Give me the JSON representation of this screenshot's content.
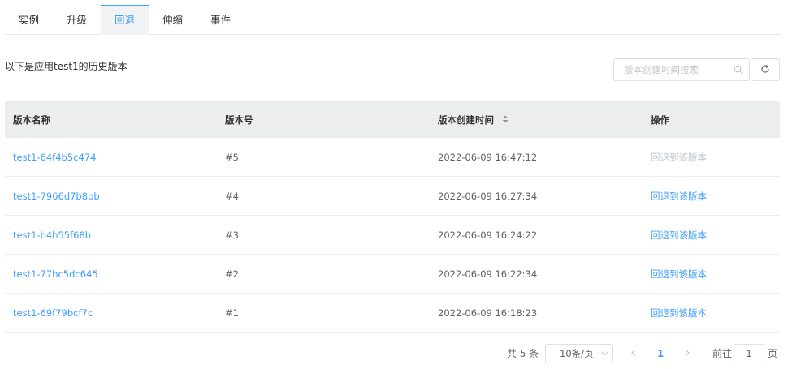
{
  "tabs": [
    {
      "label": "实例",
      "active": false
    },
    {
      "label": "升级",
      "active": false
    },
    {
      "label": "回退",
      "active": true
    },
    {
      "label": "伸缩",
      "active": false
    },
    {
      "label": "事件",
      "active": false
    }
  ],
  "description": "以下是应用test1的历史版本",
  "search": {
    "placeholder": "版本创建时间搜索",
    "value": ""
  },
  "table": {
    "headers": {
      "name": "版本名称",
      "version": "版本号",
      "created": "版本创建时间",
      "action": "操作"
    },
    "rows": [
      {
        "name": "test1-64f4b5c474",
        "version": "#5",
        "created": "2022-06-09 16:47:12",
        "action": "回退到该版本",
        "action_disabled": true
      },
      {
        "name": "test1-7966d7b8bb",
        "version": "#4",
        "created": "2022-06-09 16:27:34",
        "action": "回退到该版本",
        "action_disabled": false
      },
      {
        "name": "test1-b4b55f68b",
        "version": "#3",
        "created": "2022-06-09 16:24:22",
        "action": "回退到该版本",
        "action_disabled": false
      },
      {
        "name": "test1-77bc5dc645",
        "version": "#2",
        "created": "2022-06-09 16:22:34",
        "action": "回退到该版本",
        "action_disabled": false
      },
      {
        "name": "test1-69f79bcf7c",
        "version": "#1",
        "created": "2022-06-09 16:18:23",
        "action": "回退到该版本",
        "action_disabled": false
      }
    ]
  },
  "pagination": {
    "total_text": "共 5 条",
    "page_size": "10条/页",
    "current_page": "1",
    "goto_label": "前往",
    "goto_value": "1",
    "page_unit": "页"
  },
  "colors": {
    "accent": "#409eff",
    "disabled": "#c0c4cc",
    "header_bg": "#eceded"
  },
  "icons": {
    "search": "search-icon",
    "refresh": "refresh-icon",
    "sort": "sort-caret-icon",
    "prev": "chevron-left-icon",
    "next": "chevron-right-icon",
    "dropdown": "chevron-down-icon"
  }
}
